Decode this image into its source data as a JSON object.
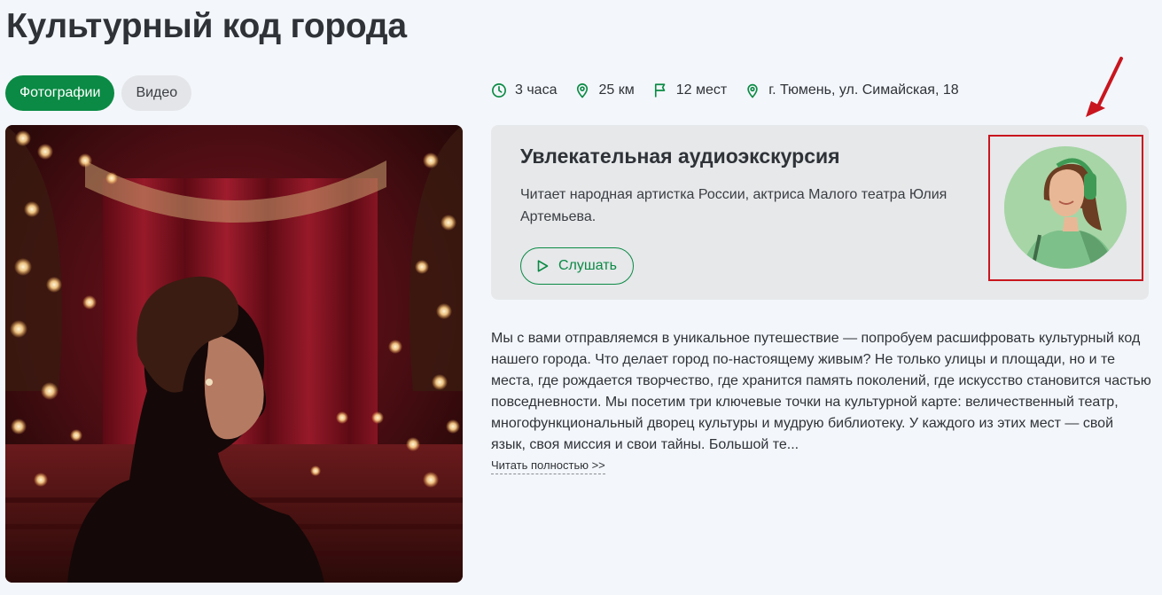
{
  "page": {
    "title": "Культурный код города"
  },
  "tabs": [
    {
      "label": "Фотографии",
      "active": true
    },
    {
      "label": "Видео",
      "active": false
    }
  ],
  "meta": {
    "duration": "3 часа",
    "distance": "25 км",
    "places": "12 мест",
    "address": "г. Тюмень, ул. Симайская, 18",
    "icons": [
      "clock-icon",
      "pin-icon",
      "flag-icon",
      "location-icon"
    ]
  },
  "audio": {
    "title": "Увлекательная аудиоэкскурсия",
    "subtitle": "Читает народная артистка России, актриса Малого театра Юлия Артемьева.",
    "button_label": "Слушать"
  },
  "description": {
    "text": "Мы с вами отправляемся в уникальное путешествие — попробуем расшифровать культурный код нашего города. Что делает город по-настоящему живым? Не только улицы и площади, но и те места, где рождается творчество, где хранится память поколений, где искусство становится частью повседневности. Мы посетим три ключевые точки на культурной карте: величественный театр, многофункциональный дворец культуры и мудрую библиотеку. У каждого из этих мест — свой язык, своя миссия и свои тайны. Большой те...",
    "read_more": "Читать полностью >>"
  },
  "colors": {
    "accent": "#0a8a44",
    "highlight": "#c9151e",
    "background": "#f3f6fa",
    "card": "#e6e8ea"
  }
}
